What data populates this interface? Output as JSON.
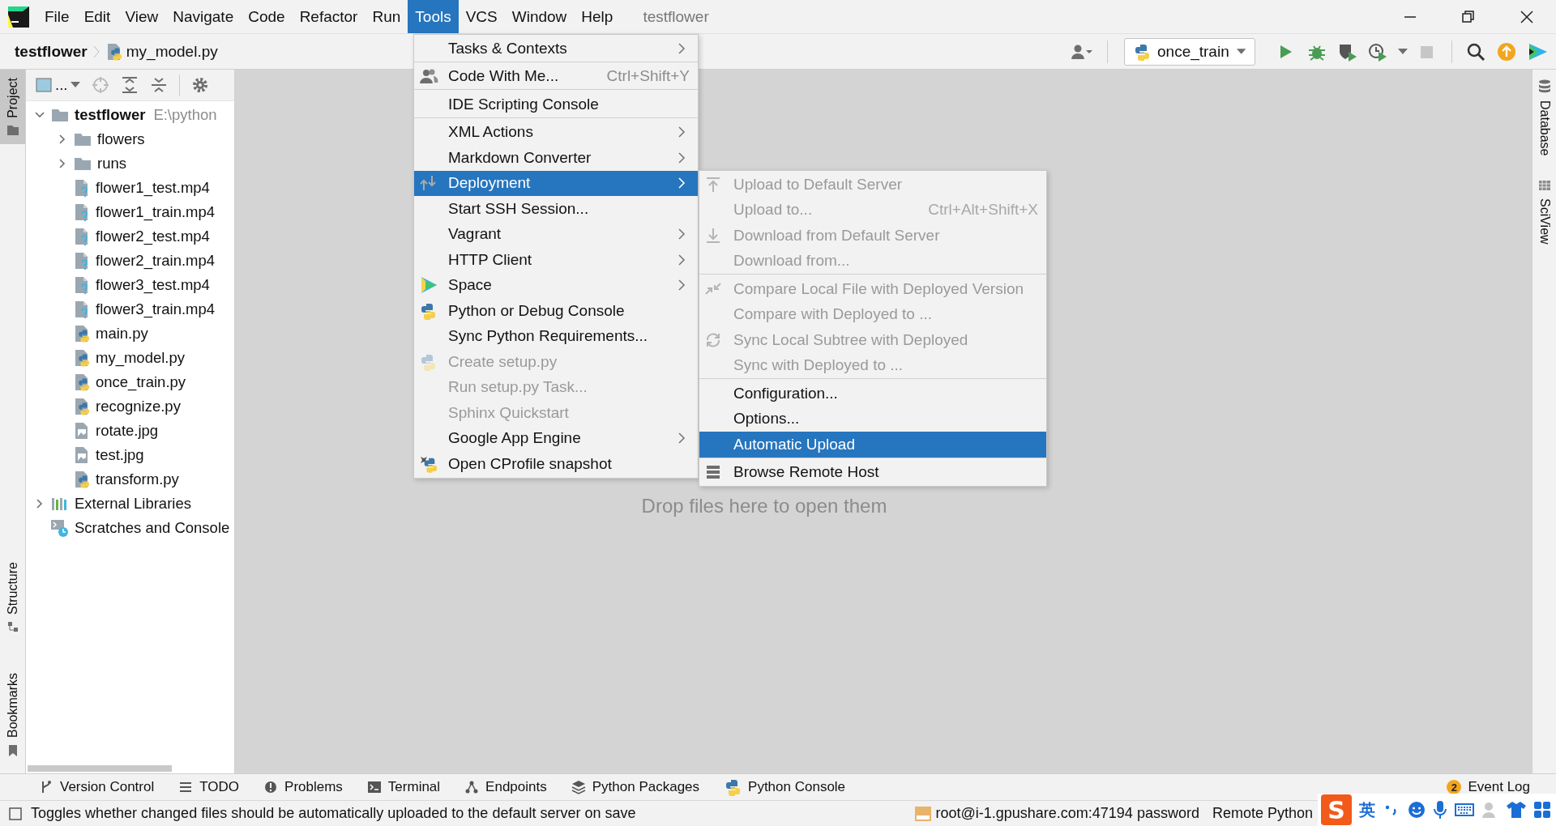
{
  "window": {
    "title": "testflower"
  },
  "menu_bar": {
    "items": [
      {
        "label": "File",
        "selected": false
      },
      {
        "label": "Edit",
        "selected": false
      },
      {
        "label": "View",
        "selected": false
      },
      {
        "label": "Navigate",
        "selected": false
      },
      {
        "label": "Code",
        "selected": false
      },
      {
        "label": "Refactor",
        "selected": false
      },
      {
        "label": "Run",
        "selected": false
      },
      {
        "label": "Tools",
        "selected": true
      },
      {
        "label": "VCS",
        "selected": false
      },
      {
        "label": "Window",
        "selected": false
      },
      {
        "label": "Help",
        "selected": false
      }
    ]
  },
  "breadcrumb": [
    {
      "label": "testflower",
      "kind": "project"
    },
    {
      "label": "my_model.py",
      "kind": "python-file"
    }
  ],
  "toolbar": {
    "run_configuration": "once_train"
  },
  "left_stripe": {
    "top": [
      {
        "label": "Project",
        "selected": true
      }
    ],
    "bottom": [
      {
        "label": "Structure",
        "selected": false
      },
      {
        "label": "Bookmarks",
        "selected": false
      }
    ]
  },
  "right_stripe": [
    {
      "label": "Database",
      "kind": "database"
    },
    {
      "label": "SciView",
      "kind": "grid"
    }
  ],
  "project_panel": {
    "view_label": "...",
    "tree": [
      {
        "name": "testflower",
        "path": "E:\\python",
        "kind": "project",
        "expanded": true,
        "children": [
          {
            "name": "flowers",
            "kind": "folder",
            "expanded": false
          },
          {
            "name": "runs",
            "kind": "folder",
            "expanded": false
          },
          {
            "name": "flower1_test.mp4",
            "kind": "unknown-file"
          },
          {
            "name": "flower1_train.mp4",
            "kind": "unknown-file"
          },
          {
            "name": "flower2_test.mp4",
            "kind": "unknown-file"
          },
          {
            "name": "flower2_train.mp4",
            "kind": "unknown-file"
          },
          {
            "name": "flower3_test.mp4",
            "kind": "unknown-file"
          },
          {
            "name": "flower3_train.mp4",
            "kind": "unknown-file"
          },
          {
            "name": "main.py",
            "kind": "python-file"
          },
          {
            "name": "my_model.py",
            "kind": "python-file"
          },
          {
            "name": "once_train.py",
            "kind": "python-file"
          },
          {
            "name": "recognize.py",
            "kind": "python-file"
          },
          {
            "name": "rotate.jpg",
            "kind": "image-file"
          },
          {
            "name": "test.jpg",
            "kind": "image-file"
          },
          {
            "name": "transform.py",
            "kind": "python-file"
          }
        ]
      },
      {
        "name": "External Libraries",
        "kind": "libraries",
        "expanded": false
      },
      {
        "name": "Scratches and Console",
        "kind": "scratches"
      }
    ]
  },
  "editor": {
    "empty_hint": "Drop files here to open them"
  },
  "tools_menu": {
    "items": [
      {
        "label": "Tasks & Contexts",
        "submenu": true,
        "disabled": false,
        "selected": false,
        "separator_after": true
      },
      {
        "label": "Code With Me...",
        "shortcut": "Ctrl+Shift+Y",
        "kind": "people",
        "submenu": false,
        "disabled": false,
        "selected": false,
        "separator_after": true
      },
      {
        "label": "IDE Scripting Console",
        "submenu": false,
        "disabled": false,
        "selected": false,
        "separator_after": true
      },
      {
        "label": "XML Actions",
        "submenu": true,
        "disabled": false,
        "selected": false,
        "separator_after": false
      },
      {
        "label": "Markdown Converter",
        "submenu": true,
        "disabled": false,
        "selected": false,
        "separator_after": false
      },
      {
        "label": "Deployment",
        "kind": "deploy",
        "submenu": true,
        "disabled": false,
        "selected": true,
        "separator_after": false
      },
      {
        "label": "Start SSH Session...",
        "submenu": false,
        "disabled": false,
        "selected": false,
        "separator_after": false
      },
      {
        "label": "Vagrant",
        "submenu": true,
        "disabled": false,
        "selected": false,
        "separator_after": false
      },
      {
        "label": "HTTP Client",
        "submenu": true,
        "disabled": false,
        "selected": false,
        "separator_after": false
      },
      {
        "label": "Space",
        "kind": "space",
        "submenu": true,
        "disabled": false,
        "selected": false,
        "separator_after": false
      },
      {
        "label": "Python or Debug Console",
        "kind": "python",
        "submenu": false,
        "disabled": false,
        "selected": false,
        "separator_after": false
      },
      {
        "label": "Sync Python Requirements...",
        "submenu": false,
        "disabled": false,
        "selected": false,
        "separator_after": false
      },
      {
        "label": "Create setup.py",
        "kind": "setup",
        "submenu": false,
        "disabled": true,
        "selected": false,
        "separator_after": false
      },
      {
        "label": "Run setup.py Task...",
        "submenu": false,
        "disabled": true,
        "selected": false,
        "separator_after": false
      },
      {
        "label": "Sphinx Quickstart",
        "submenu": false,
        "disabled": true,
        "selected": false,
        "separator_after": false
      },
      {
        "label": "Google App Engine",
        "submenu": true,
        "disabled": false,
        "selected": false,
        "separator_after": false
      },
      {
        "label": "Open CProfile snapshot",
        "kind": "profile",
        "submenu": false,
        "disabled": false,
        "selected": false,
        "separator_after": false
      }
    ]
  },
  "deployment_submenu": {
    "items": [
      {
        "label": "Upload to Default Server",
        "kind": "upload",
        "submenu": false,
        "disabled": true,
        "selected": false,
        "separator_after": false
      },
      {
        "label": "Upload to...",
        "shortcut": "Ctrl+Alt+Shift+X",
        "submenu": false,
        "disabled": true,
        "selected": false,
        "separator_after": false
      },
      {
        "label": "Download from Default Server",
        "kind": "download",
        "submenu": false,
        "disabled": true,
        "selected": false,
        "separator_after": false
      },
      {
        "label": "Download from...",
        "submenu": false,
        "disabled": true,
        "selected": false,
        "separator_after": true
      },
      {
        "label": "Compare Local File with Deployed Version",
        "kind": "compare",
        "submenu": false,
        "disabled": true,
        "selected": false,
        "separator_after": false
      },
      {
        "label": "Compare with Deployed to ...",
        "submenu": false,
        "disabled": true,
        "selected": false,
        "separator_after": false
      },
      {
        "label": "Sync Local Subtree with Deployed",
        "kind": "sync",
        "submenu": false,
        "disabled": true,
        "selected": false,
        "separator_after": false
      },
      {
        "label": "Sync with Deployed to ...",
        "submenu": false,
        "disabled": true,
        "selected": false,
        "separator_after": true
      },
      {
        "label": "Configuration...",
        "submenu": false,
        "disabled": false,
        "selected": false,
        "separator_after": false
      },
      {
        "label": "Options...",
        "submenu": false,
        "disabled": false,
        "selected": false,
        "separator_after": false
      },
      {
        "label": "Automatic Upload",
        "submenu": false,
        "disabled": false,
        "selected": true,
        "separator_after": true
      },
      {
        "label": "Browse Remote Host",
        "kind": "server",
        "submenu": false,
        "disabled": false,
        "selected": false,
        "separator_after": false
      }
    ]
  },
  "tool_windows": [
    {
      "label": "Version Control",
      "kind": "branch"
    },
    {
      "label": "TODO",
      "kind": "list"
    },
    {
      "label": "Problems",
      "kind": "problems"
    },
    {
      "label": "Terminal",
      "kind": "terminal"
    },
    {
      "label": "Endpoints",
      "kind": "endpoints"
    },
    {
      "label": "Python Packages",
      "kind": "packages"
    },
    {
      "label": "Python Console",
      "kind": "python"
    }
  ],
  "event_log": {
    "label": "Event Log",
    "badge": "2"
  },
  "status_bar": {
    "message": "Toggles whether changed files should be automatically uploaded to the default server on save",
    "connection": "root@i-1.gpushare.com:47194 password",
    "interpreter": "Remote Python"
  },
  "ime_bar": {
    "logo": "S",
    "mode": "英"
  }
}
